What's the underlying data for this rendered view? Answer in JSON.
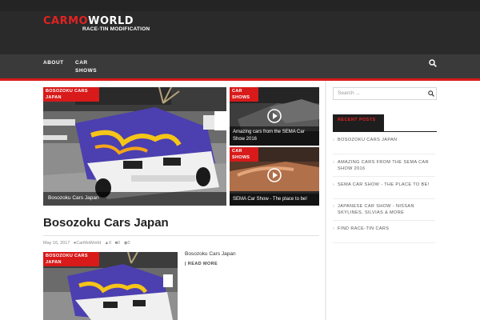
{
  "brand": {
    "logo_part1": "CARMO",
    "logo_part2": "WORLD",
    "tagline": "RACE-TIN MODIFICATION"
  },
  "nav": {
    "items": [
      {
        "label": "ABOUT"
      },
      {
        "label": "CAR SHOWS"
      }
    ],
    "search_icon": "search-icon"
  },
  "featured": {
    "main": {
      "tag": "BOSOZOKU CARS JAPAN",
      "title": "Bosozoku Cars Japan"
    },
    "side": [
      {
        "tag": "CAR SHOWS",
        "title": "Amazing cars from the SEMA Car Show 2016"
      },
      {
        "tag": "CAR SHOWS",
        "title": "SEMA Car Show - The place to be!"
      }
    ]
  },
  "post": {
    "title": "Bosozoku Cars Japan",
    "date": "May 16, 2017",
    "author": "CarMoWorld",
    "likes": "0",
    "comments": "0",
    "views": "0",
    "thumb_tag": "BOSOZOKU CARS JAPAN",
    "excerpt": "Bosozoku Cars Japan",
    "read_more": "READ MORE"
  },
  "sidebar": {
    "search_placeholder": "Search ...",
    "recent_title": "RECENT POSTS",
    "recent_posts": [
      "BOSOZOKU CARS JAPAN",
      "AMAZING CARS FROM THE SEMA CAR SHOW 2016",
      "SEMA CAR SHOW - THE PLACE TO BE!",
      "JAPANESE CAR SHOW - NISSAN SKYLINES, SILVIAS & MORE",
      "FIND RACE-TIN CARS"
    ]
  },
  "colors": {
    "accent": "#d81a1a",
    "header_bg": "#2a2a2a",
    "nav_bg": "#3a3a3a"
  }
}
